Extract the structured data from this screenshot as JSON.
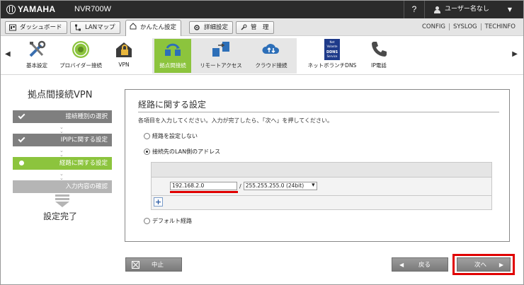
{
  "header": {
    "brand": "YAMAHA",
    "model": "NVR700W",
    "help": "?",
    "user": "ユーザー名なし"
  },
  "tabs": {
    "dashboard": "ダッシュボード",
    "lanmap": "LANマップ",
    "easy_setup": "かんたん設定",
    "advanced": "詳細設定",
    "admin": "管　理"
  },
  "toplinks": [
    "CONFIG",
    "SYSLOG",
    "TECHINFO"
  ],
  "menu": {
    "basic": "基本設定",
    "provider": "プロバイダー接続",
    "vpn": "VPN",
    "site_vpn": "拠点間接続",
    "remote_access": "リモートアクセス",
    "cloud": "クラウド接続",
    "netvolante": "ネットボランチDNS",
    "ddns_logo_lines": [
      "Net",
      "Volante",
      "DDNS",
      "Service"
    ],
    "ip_phone": "IP電話"
  },
  "sidebar": {
    "title": "拠点間接続VPN",
    "steps": [
      {
        "label": "接続種別の選択",
        "state": "done"
      },
      {
        "label": "IPIPに関する設定",
        "state": "done"
      },
      {
        "label": "経路に関する設定",
        "state": "current"
      },
      {
        "label": "入力内容の確認",
        "state": "todo"
      }
    ],
    "finish": "設定完了"
  },
  "panel": {
    "title": "経路に関する設定",
    "instruction": "各項目を入力してください。入力が完了したら、「次へ」を押してください。",
    "options": {
      "none": "経路を設定しない",
      "lan": "接続先のLAN側のアドレス",
      "default": "デフォルト経路"
    },
    "selected_option": "lan",
    "ip_value": "192.168.2.0",
    "separator": "/",
    "mask_value": "255.255.255.0 (24bit)",
    "add_label": "+"
  },
  "buttons": {
    "cancel": "中止",
    "back": "戻る",
    "next": "次へ"
  },
  "colors": {
    "accent_green": "#8cc43d",
    "highlight_red": "#e00000",
    "header_bg": "#2b2b2b"
  }
}
